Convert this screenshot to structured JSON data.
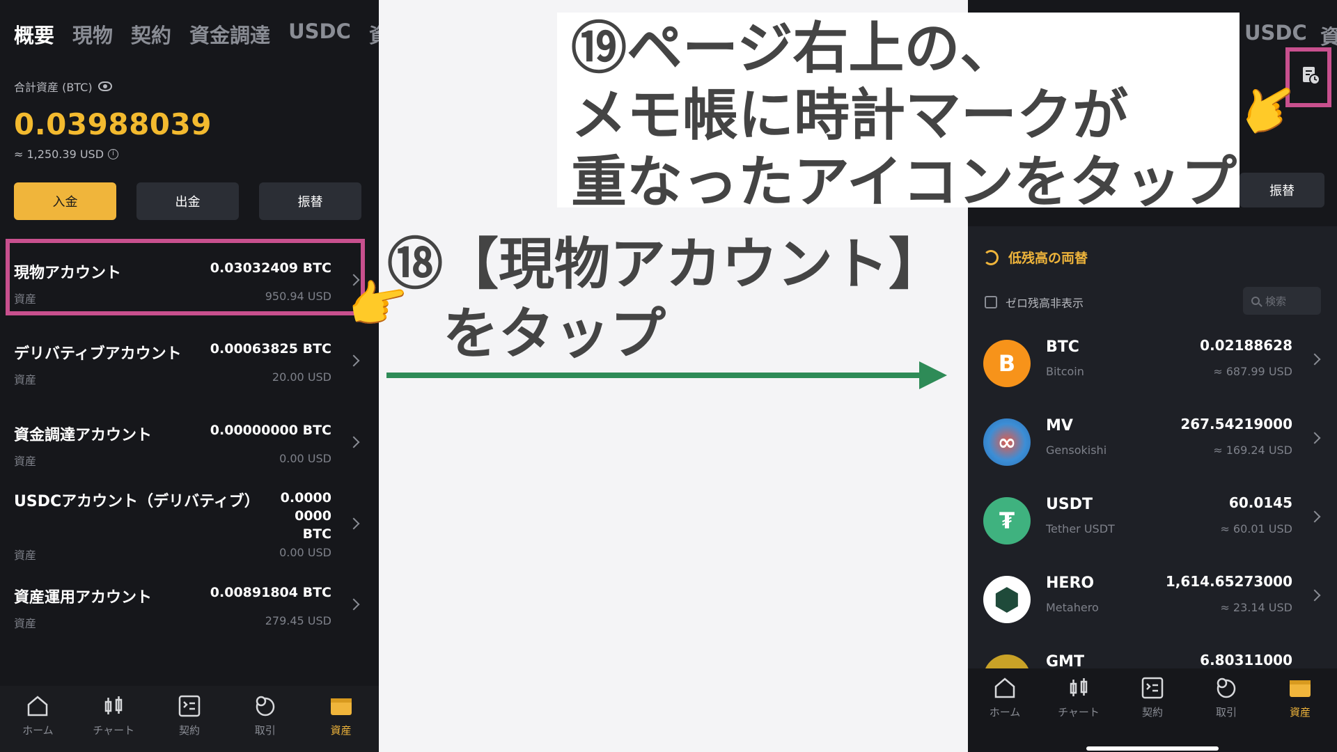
{
  "left": {
    "tabs": [
      "概要",
      "現物",
      "契約",
      "資金調達",
      "USDC",
      "資"
    ],
    "total_label": "合計資産 (BTC)",
    "total_value": "0.03988039",
    "total_usd": "≈ 1,250.39 USD",
    "buttons": {
      "deposit": "入金",
      "withdraw": "出金",
      "transfer": "振替"
    },
    "accounts": [
      {
        "name": "現物アカウント",
        "sub": "資産",
        "btc": "0.03032409 BTC",
        "usd": "950.94 USD"
      },
      {
        "name": "デリバティブアカウント",
        "sub": "資産",
        "btc": "0.00063825 BTC",
        "usd": "20.00 USD"
      },
      {
        "name": "資金調達アカウント",
        "sub": "資産",
        "btc": "0.00000000 BTC",
        "usd": "0.00 USD"
      },
      {
        "name": "USDCアカウント（デリバティブ）",
        "sub": "資産",
        "btc_lines": [
          "0.0000",
          "0000",
          "BTC"
        ],
        "usd": "0.00 USD"
      },
      {
        "name": "資産運用アカウント",
        "sub": "資産",
        "btc": "0.00891804 BTC",
        "usd": "279.45 USD"
      }
    ],
    "nav": [
      {
        "label": "ホーム",
        "icon": "home-icon"
      },
      {
        "label": "チャート",
        "icon": "candlestick-icon"
      },
      {
        "label": "契約",
        "icon": "contract-icon"
      },
      {
        "label": "取引",
        "icon": "trade-icon"
      },
      {
        "label": "資産",
        "icon": "wallet-icon"
      }
    ]
  },
  "right": {
    "tabs": [
      "USDC",
      "資"
    ],
    "transfer": "振替",
    "convert_small": "低残高の両替",
    "hide_zero": "ゼロ残高非表示",
    "search_placeholder": "検索",
    "coins": [
      {
        "symbol": "BTC",
        "name": "Bitcoin",
        "amount": "0.02188628",
        "usd": "≈ 687.99 USD",
        "logo": "bitcoin-logo",
        "color": "#f7931a",
        "glyph": "B"
      },
      {
        "symbol": "MV",
        "name": "Gensokishi",
        "amount": "267.54219000",
        "usd": "≈ 169.24 USD",
        "logo": "gensokishi-logo",
        "color": "#2a6fb3",
        "glyph": "∞"
      },
      {
        "symbol": "USDT",
        "name": "Tether USDT",
        "amount": "60.0145",
        "usd": "≈ 60.01 USD",
        "logo": "tether-logo",
        "color": "#3fb27f",
        "glyph": "₮"
      },
      {
        "symbol": "HERO",
        "name": "Metahero",
        "amount": "1,614.65273000",
        "usd": "≈ 23.14 USD",
        "logo": "metahero-logo",
        "color": "#ffffff",
        "glyph": "⬢"
      },
      {
        "symbol": "GMT",
        "name": "",
        "amount": "6.80311000",
        "usd": "",
        "logo": "gmt-logo",
        "color": "#c9a227",
        "glyph": ""
      }
    ],
    "nav": [
      {
        "label": "ホーム",
        "icon": "home-icon"
      },
      {
        "label": "チャート",
        "icon": "candlestick-icon"
      },
      {
        "label": "契約",
        "icon": "contract-icon"
      },
      {
        "label": "取引",
        "icon": "trade-icon"
      },
      {
        "label": "資産",
        "icon": "wallet-icon"
      }
    ]
  },
  "annotations": {
    "step19": [
      "⑲ページ右上の、",
      "メモ帳に時計マークが",
      "重なったアイコンをタップ"
    ],
    "step18": [
      "⑱【現物アカウント】",
      "　をタップ"
    ],
    "colors": {
      "highlight": "#c8508e",
      "arrow": "#2e8b57",
      "accent": "#f0b53b"
    }
  }
}
